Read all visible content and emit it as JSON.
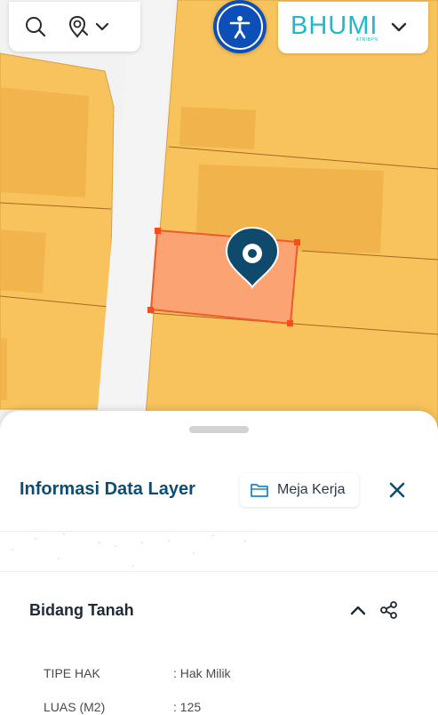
{
  "map": {
    "colors": {
      "parcel": "#f8c35c",
      "parcel_alt": "#f3b54f",
      "road": "#f2f2f2",
      "selected": "#fca373",
      "pin": "#0f4a6c"
    },
    "icons": [
      "search-icon",
      "location-search-icon",
      "chevron-down-icon",
      "accessibility-icon",
      "map-pin-icon"
    ]
  },
  "brand": {
    "name": "BHUMI",
    "sub": "ATR/BPN"
  },
  "sheet": {
    "title": "Informasi Data Layer",
    "workdesk_label": "Meja Kerja",
    "section_title": "Bidang Tanah",
    "rows": [
      {
        "key": "TIPE HAK",
        "value": ": Hak Milik"
      },
      {
        "key": "LUAS (M2)",
        "value": ": 125"
      }
    ]
  },
  "accent_color": "#0f4c73"
}
